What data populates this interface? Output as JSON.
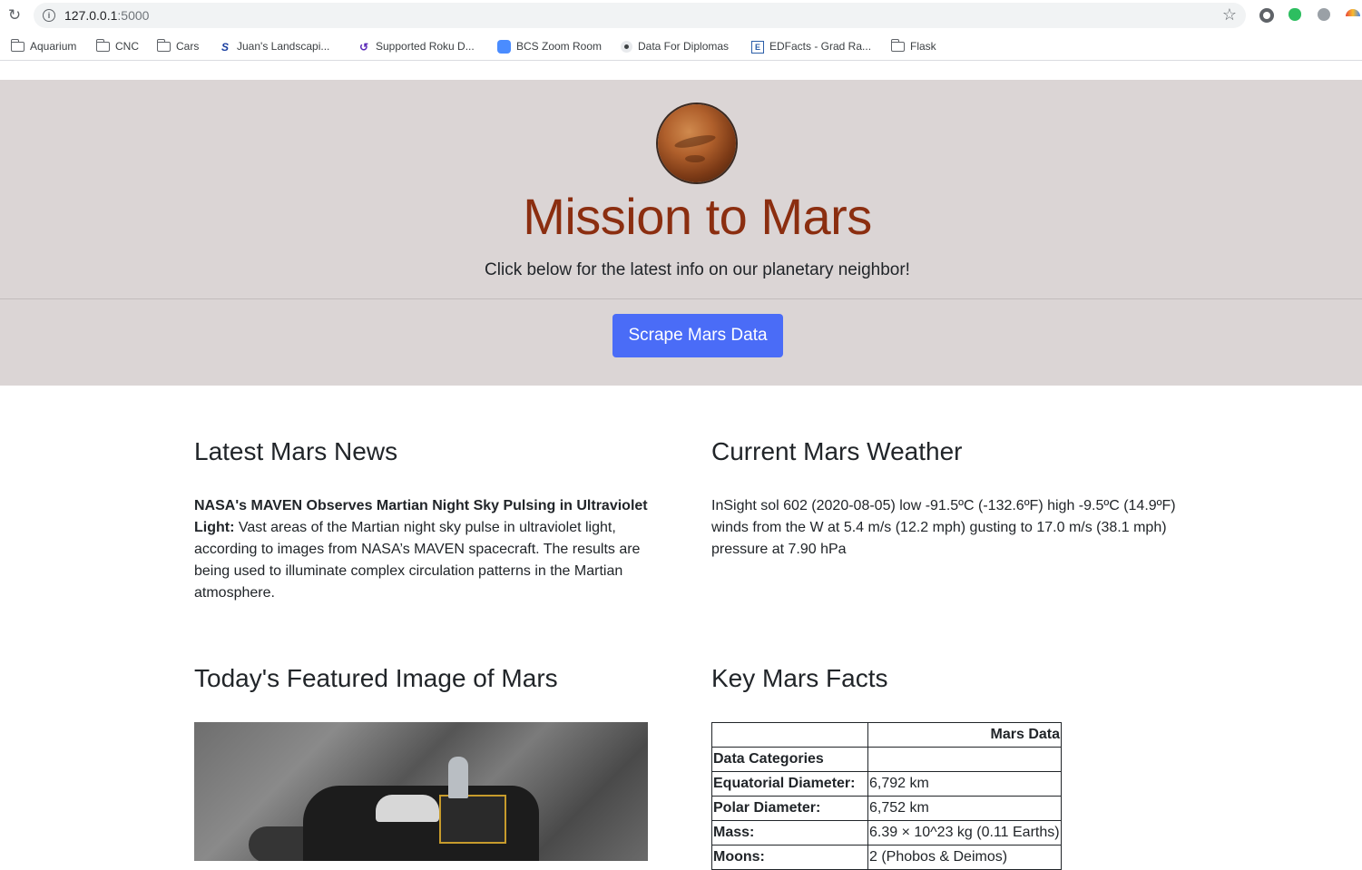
{
  "browser": {
    "url_host": "127.0.0.1",
    "url_port": ":5000",
    "bookmarks": [
      {
        "label": "Aquarium",
        "icon": "folder-icon"
      },
      {
        "label": "CNC",
        "icon": "folder-icon"
      },
      {
        "label": "Cars",
        "icon": "folder-icon"
      },
      {
        "label": "Juan's Landscapi...",
        "icon": "site-favicon"
      },
      {
        "label": "Supported Roku D...",
        "icon": "roku-favicon"
      },
      {
        "label": "BCS Zoom Room",
        "icon": "zoom-favicon"
      },
      {
        "label": "Data For Diplomas",
        "icon": "site-favicon"
      },
      {
        "label": "EDFacts - Grad Ra...",
        "icon": "edfacts-favicon"
      },
      {
        "label": "Flask",
        "icon": "folder-icon"
      }
    ]
  },
  "header": {
    "title": "Mission to Mars",
    "lead": "Click below for the latest info on our planetary neighbor!",
    "button_label": "Scrape Mars Data",
    "title_color": "#8b2e10",
    "jumbotron_bg": "#dbd5d5",
    "button_color": "#4a6cf7"
  },
  "news": {
    "heading": "Latest Mars News",
    "headline": "NASA's MAVEN Observes Martian Night Sky Pulsing in Ultraviolet Light:",
    "body": " Vast areas of the Martian night sky pulse in ultraviolet light, according to images from NASA’s MAVEN spacecraft. The results are being used to illuminate complex circulation patterns in the Martian atmosphere."
  },
  "weather": {
    "heading": "Current Mars Weather",
    "text": "InSight sol 602 (2020-08-05) low -91.5ºC (-132.6ºF) high -9.5ºC (14.9ºF) winds from the W at 5.4 m/s (12.2 mph) gusting to 17.0 m/s (38.1 mph) pressure at 7.90 hPa"
  },
  "featured": {
    "heading": "Today's Featured Image of Mars"
  },
  "facts": {
    "heading": "Key Mars Facts",
    "column_header": "Mars Data",
    "index_label": "Data Categories",
    "rows": [
      {
        "key": "Equatorial Diameter:",
        "value": "6,792 km"
      },
      {
        "key": "Polar Diameter:",
        "value": "6,752 km"
      },
      {
        "key": "Mass:",
        "value": "6.39 × 10^23 kg (0.11 Earths)"
      },
      {
        "key": "Moons:",
        "value": "2 (Phobos & Deimos)"
      }
    ]
  }
}
